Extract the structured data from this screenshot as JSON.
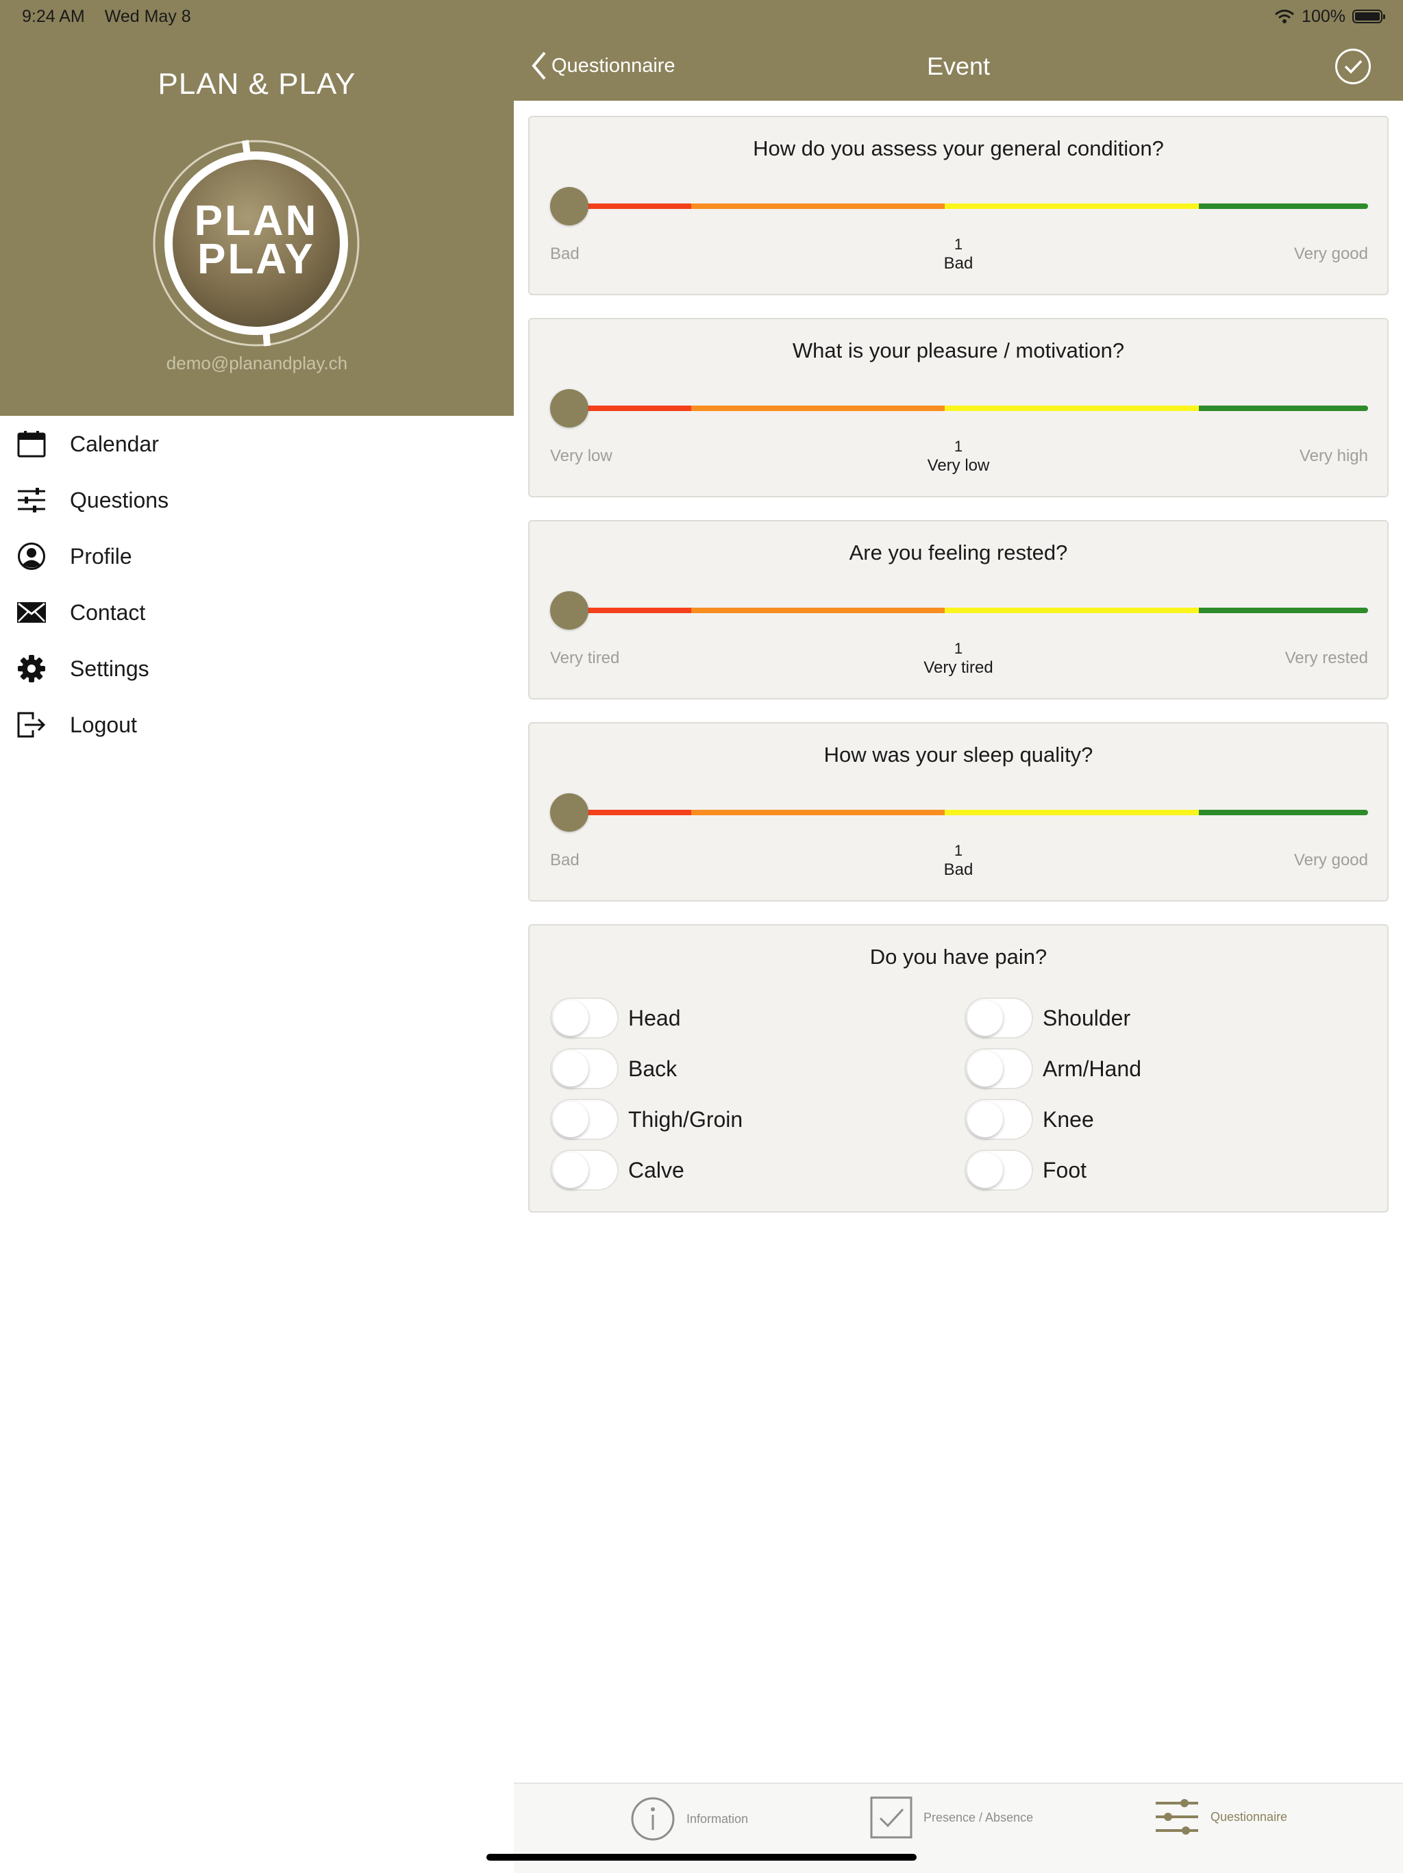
{
  "status_bar": {
    "time": "9:24 AM",
    "date": "Wed May 8",
    "battery": "100%"
  },
  "sidebar": {
    "app_title": "PLAN & PLAY",
    "logo_text_top": "PLAN",
    "logo_text_bottom": "PLAY",
    "user_email": "demo@planandplay.ch",
    "items": [
      {
        "label": "Calendar",
        "icon": "calendar-icon"
      },
      {
        "label": "Questions",
        "icon": "sliders-icon"
      },
      {
        "label": "Profile",
        "icon": "profile-icon"
      },
      {
        "label": "Contact",
        "icon": "envelope-icon"
      },
      {
        "label": "Settings",
        "icon": "gear-icon"
      },
      {
        "label": "Logout",
        "icon": "logout-icon"
      }
    ]
  },
  "nav": {
    "back_label": "Questionnaire",
    "title": "Event"
  },
  "colors": {
    "brand": "#8b825b",
    "scale": [
      "#f5401c",
      "#f98d1f",
      "#fbf51e",
      "#2e8b2a"
    ]
  },
  "questions": [
    {
      "title": "How do you assess your general condition?",
      "min_label": "Bad",
      "max_label": "Very good",
      "value": "1",
      "value_label": "Bad"
    },
    {
      "title": "What is your pleasure / motivation?",
      "min_label": "Very low",
      "max_label": "Very high",
      "value": "1",
      "value_label": "Very low"
    },
    {
      "title": "Are you feeling rested?",
      "min_label": "Very tired",
      "max_label": "Very rested",
      "value": "1",
      "value_label": "Very tired"
    },
    {
      "title": "How was your sleep quality?",
      "min_label": "Bad",
      "max_label": "Very good",
      "value": "1",
      "value_label": "Bad"
    }
  ],
  "pain": {
    "title": "Do you have pain?",
    "items": [
      {
        "label": "Head",
        "on": false
      },
      {
        "label": "Shoulder",
        "on": false
      },
      {
        "label": "Back",
        "on": false
      },
      {
        "label": "Arm/Hand",
        "on": false
      },
      {
        "label": "Thigh/Groin",
        "on": false
      },
      {
        "label": "Knee",
        "on": false
      },
      {
        "label": "Calve",
        "on": false
      },
      {
        "label": "Foot",
        "on": false
      }
    ]
  },
  "tabbar": {
    "items": [
      {
        "label": "Information",
        "icon": "info-icon",
        "active": false
      },
      {
        "label": "Presence / Absence",
        "icon": "checkbox-icon",
        "active": false
      },
      {
        "label": "Questionnaire",
        "icon": "sliders-icon",
        "active": true
      }
    ]
  }
}
